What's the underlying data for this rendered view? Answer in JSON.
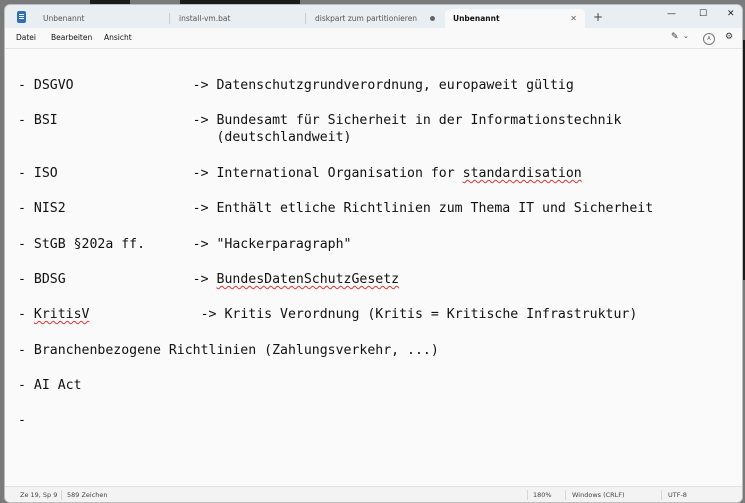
{
  "tabs": [
    {
      "label": "Unbenannt",
      "active": false
    },
    {
      "label": "install-vm.bat",
      "active": false
    },
    {
      "label": "diskpart   zum partitionieren",
      "active": false,
      "modified": true
    },
    {
      "label": "Unbenannt",
      "active": true
    }
  ],
  "new_tab_label": "+",
  "window_controls": {
    "minimize": "—",
    "maximize": "☐",
    "close": "✕"
  },
  "menu": {
    "file": "Datei",
    "edit": "Bearbeiten",
    "view": "Ansicht"
  },
  "menubar_icons": {
    "copilot": "✎",
    "copilot_dropdown": "⌄",
    "account_initial": "A",
    "settings": "⚙"
  },
  "editor": {
    "lines": [
      {
        "prefix": "- DSGVO               -> Datenschutzgrundverordnung, europaweit gültig"
      },
      {
        "prefix": "- BSI                 -> Bundesamt für Sicherheit in der Informationstechnik"
      },
      {
        "prefix": "                         (deutschlandweit)"
      },
      {
        "prefix": "- ISO                 -> International Organisation for ",
        "underlined": "standardisation"
      },
      {
        "prefix": "- NIS2                -> Enthält etliche Richtlinien zum Thema IT und Sicherheit"
      },
      {
        "prefix": "- StGB §202a ff.      -> \"Hackerparagraph\""
      },
      {
        "prefix": "- BDSG                -> ",
        "underlined": "BundesDatenSchutzGesetz"
      },
      {
        "lead": "- ",
        "underlined": "KritisV",
        "prefix": "              -> Kritis Verordnung (Kritis = Kritische Infrastruktur)"
      },
      {
        "prefix": "- Branchenbezogene Richtlinien (Zahlungsverkehr, ...)"
      },
      {
        "prefix": "- AI Act"
      },
      {
        "prefix": "-"
      }
    ]
  },
  "status": {
    "position": "Ze 19, Sp 9",
    "char_count": "589 Zeichen",
    "zoom": "180%",
    "line_ending": "Windows (CRLF)",
    "encoding": "UTF-8"
  }
}
